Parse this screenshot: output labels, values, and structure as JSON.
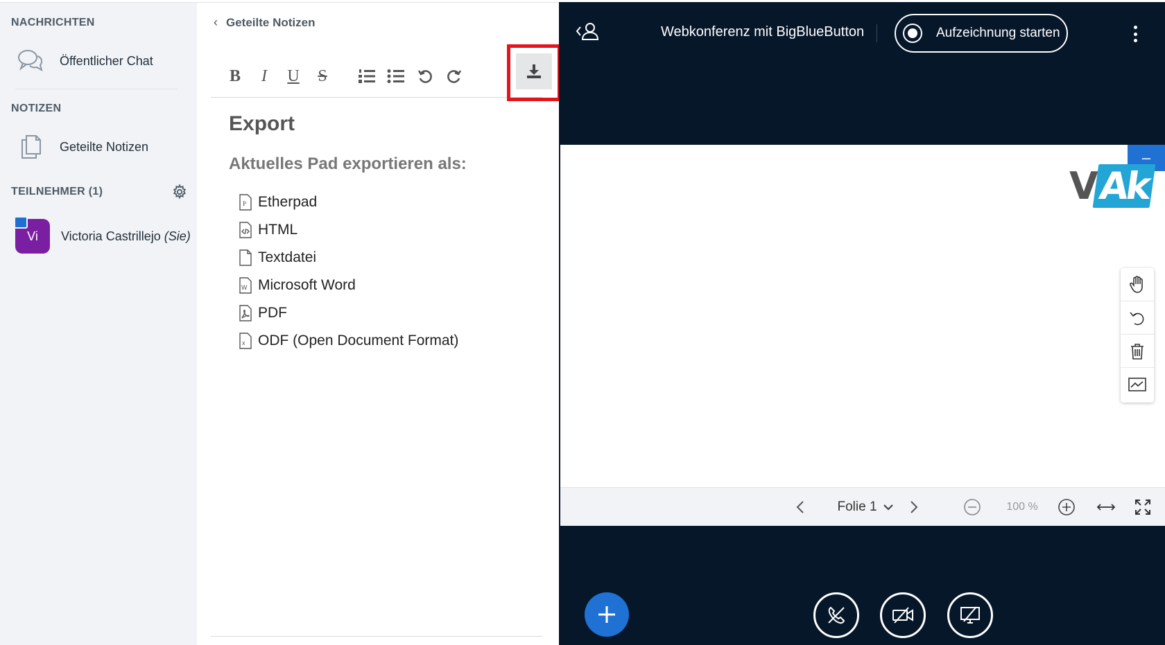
{
  "sidebar": {
    "messages_title": "NACHRICHTEN",
    "public_chat": "Öffentlicher Chat",
    "notes_title": "NOTIZEN",
    "shared_notes": "Geteilte Notizen",
    "participants_title": "TEILNEHMER (1)",
    "user": {
      "initials": "Vi",
      "name": "Victoria Castrillejo",
      "you": "(Sie)",
      "avatar_color": "#7b1fa2"
    }
  },
  "notes": {
    "back_label": "Geteilte Notizen",
    "toolbar": {
      "bold": "B",
      "italic": "I",
      "underline": "U",
      "strike": "S",
      "ordered_list": "ordered-list-icon",
      "unordered_list": "unordered-list-icon",
      "undo": "undo-icon",
      "redo": "redo-icon",
      "export": "download-icon"
    },
    "export": {
      "title": "Export",
      "subtitle": "Aktuelles Pad exportieren als:",
      "options": [
        "Etherpad",
        "HTML",
        "Textdatei",
        "Microsoft Word",
        "PDF",
        "ODF (Open Document Format)"
      ]
    },
    "highlight_color": "#e3141c"
  },
  "main": {
    "title": "Webkonferenz mit BigBlueButton",
    "record_label": "Aufzeichnung starten",
    "slide_label": "Folie 1",
    "zoom": "100 %",
    "logo": {
      "v": "V",
      "ak": "Ak"
    },
    "minimize": "–",
    "colors": {
      "background": "#06172a",
      "accent": "#1f72d4"
    }
  }
}
